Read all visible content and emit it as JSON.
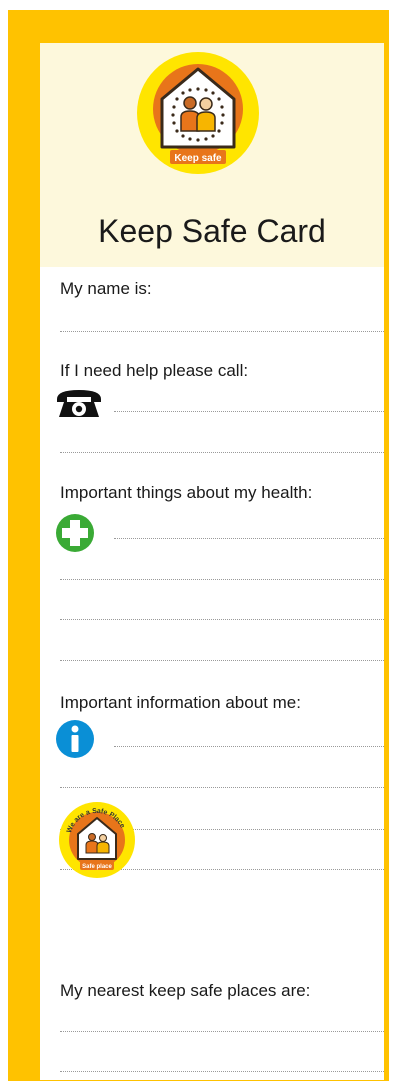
{
  "card": {
    "title": "Keep Safe Card",
    "logo_text": "Keep safe",
    "safe_place_badge": {
      "arc_text": "We are a Safe Place",
      "bottom_text": "Safe place"
    }
  },
  "sections": {
    "name_label": "My name is:",
    "help_label": "If I need help please call:",
    "health_label": "Important things about my health:",
    "info_label": "Important information about me:",
    "places_label": "My nearest keep safe places are:"
  },
  "icons": {
    "phone": "telephone-icon",
    "health": "green-cross-icon",
    "info": "info-icon"
  },
  "colors": {
    "frame": "#ffc200",
    "header_bg": "#fdf8dc",
    "logo_orange": "#e8751a",
    "logo_yellow": "#ffe500",
    "cross_green": "#3aaa35",
    "info_blue": "#0a8fd6"
  }
}
